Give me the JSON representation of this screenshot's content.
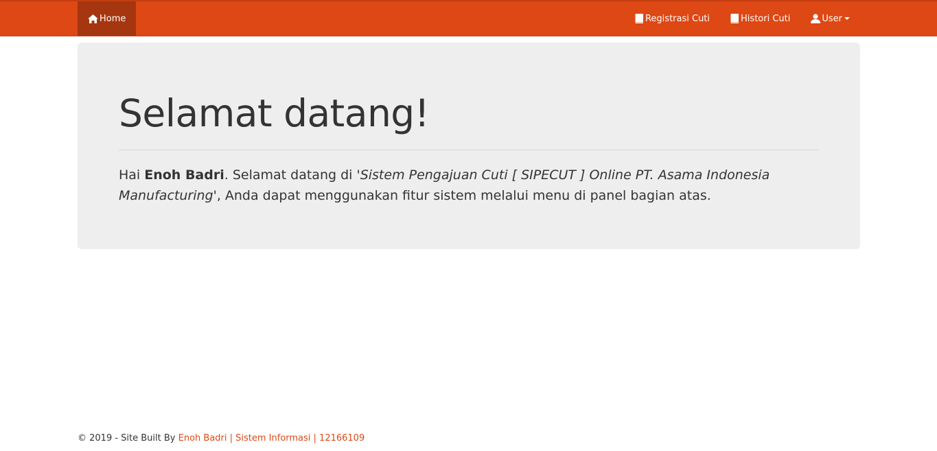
{
  "nav": {
    "home_label": "Home",
    "registrasi_label": "Registrasi Cuti",
    "histori_label": "Histori Cuti",
    "user_label": "User"
  },
  "jumbotron": {
    "title": "Selamat datang!",
    "greeting_prefix": "Hai ",
    "user_name": "Enoh Badri",
    "welcome_text": ". Selamat datang di ",
    "system_name": "'Sistem Pengajuan Cuti [ SIPECUT ] Online PT. Asama Indonesia Manufacturing'",
    "instruction_text": ", Anda dapat menggunakan fitur sistem melalui menu di panel bagian atas."
  },
  "footer": {
    "copyright_text": "© 2019 - Site Built By ",
    "credit_link": "Enoh Badri | Sistem Informasi | 12166109"
  },
  "colors": {
    "navbar": "#dd4814",
    "navbar_active": "#a5360f",
    "jumbotron_bg": "#eeeeee",
    "link": "#dd4814"
  },
  "icons": {
    "home": "home-icon",
    "registrasi": "book-icon",
    "histori": "book-icon",
    "user": "user-icon"
  }
}
